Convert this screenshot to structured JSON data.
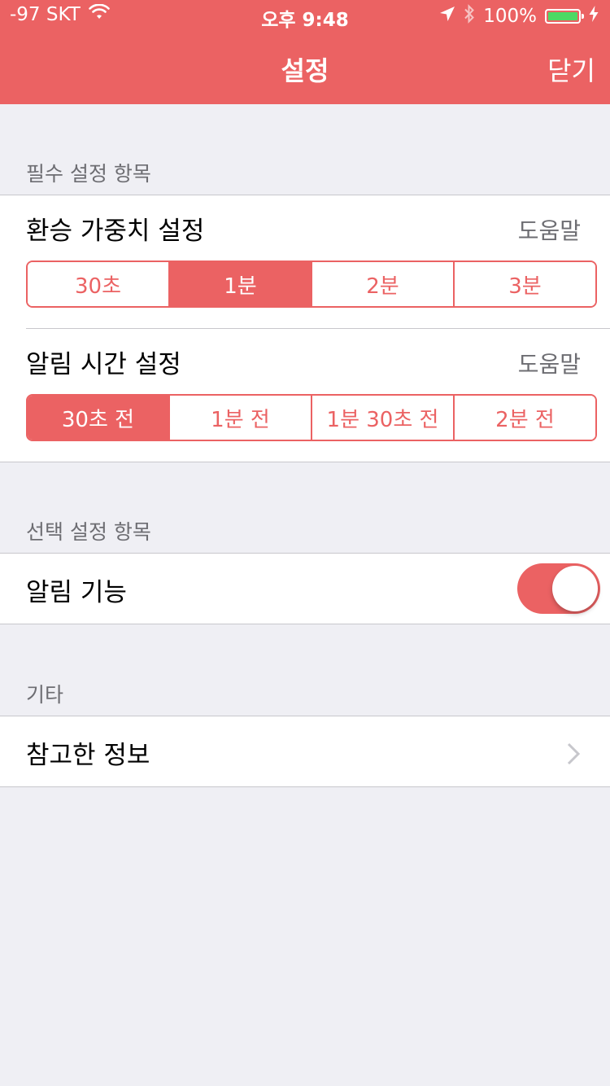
{
  "status_bar": {
    "carrier": "-97 SKT",
    "time": "오후 9:48",
    "battery": "100%",
    "icons": [
      "wifi-icon",
      "location-arrow-icon",
      "bluetooth-icon",
      "battery-icon",
      "charging-bolt-icon"
    ]
  },
  "nav": {
    "title": "설정",
    "close_label": "닫기"
  },
  "required": {
    "header": "필수 설정 항목",
    "transfer": {
      "title": "환승 가중치 설정",
      "help": "도움말",
      "options": [
        "30초",
        "1분",
        "2분",
        "3분"
      ],
      "selected": "1분"
    },
    "alarm_time": {
      "title": "알림 시간 설정",
      "help": "도움말",
      "options": [
        "30초 전",
        "1분 전",
        "1분 30초 전",
        "2분 전"
      ],
      "selected": "30초 전"
    }
  },
  "optional": {
    "header": "선택 설정 항목",
    "alarm_feature": {
      "title": "알림 기능",
      "enabled": true
    }
  },
  "etc": {
    "header": "기타",
    "references": {
      "title": "참고한 정보"
    }
  },
  "colors": {
    "accent": "#eb6263",
    "background": "#efeff4",
    "separator": "#c8c7cc",
    "secondary_text": "#6d6d72"
  }
}
